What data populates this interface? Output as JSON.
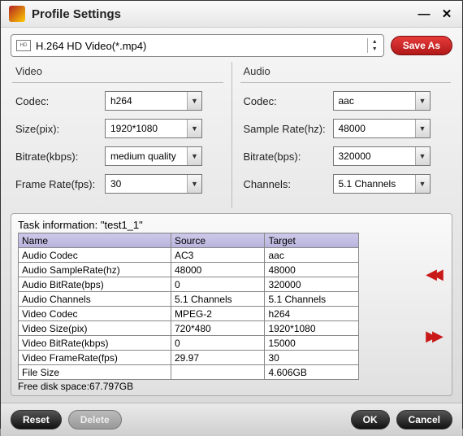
{
  "window": {
    "title": "Profile Settings"
  },
  "profile": {
    "name": "H.264 HD Video(*.mp4)",
    "icon_label": "HD"
  },
  "save_as": "Save As",
  "video": {
    "title": "Video",
    "codec_label": "Codec:",
    "codec": "h264",
    "size_label": "Size(pix):",
    "size": "1920*1080",
    "bitrate_label": "Bitrate(kbps):",
    "bitrate": "medium quality",
    "framerate_label": "Frame Rate(fps):",
    "framerate": "30"
  },
  "audio": {
    "title": "Audio",
    "codec_label": "Codec:",
    "codec": "aac",
    "samplerate_label": "Sample Rate(hz):",
    "samplerate": "48000",
    "bitrate_label": "Bitrate(bps):",
    "bitrate": "320000",
    "channels_label": "Channels:",
    "channels": "5.1 Channels"
  },
  "task": {
    "title": "Task information: \"test1_1\"",
    "headers": {
      "name": "Name",
      "source": "Source",
      "target": "Target"
    },
    "rows": [
      {
        "name": "Audio Codec",
        "source": "AC3",
        "target": "aac"
      },
      {
        "name": "Audio SampleRate(hz)",
        "source": "48000",
        "target": "48000"
      },
      {
        "name": "Audio BitRate(bps)",
        "source": "0",
        "target": "320000"
      },
      {
        "name": "Audio Channels",
        "source": "5.1 Channels",
        "target": "5.1 Channels"
      },
      {
        "name": "Video Codec",
        "source": "MPEG-2",
        "target": "h264"
      },
      {
        "name": "Video Size(pix)",
        "source": "720*480",
        "target": "1920*1080"
      },
      {
        "name": "Video BitRate(kbps)",
        "source": "0",
        "target": "15000"
      },
      {
        "name": "Video FrameRate(fps)",
        "source": "29.97",
        "target": "30"
      },
      {
        "name": "File Size",
        "source": "",
        "target": "4.606GB"
      }
    ],
    "free_space": "Free disk space:67.797GB"
  },
  "buttons": {
    "reset": "Reset",
    "delete": "Delete",
    "ok": "OK",
    "cancel": "Cancel"
  }
}
